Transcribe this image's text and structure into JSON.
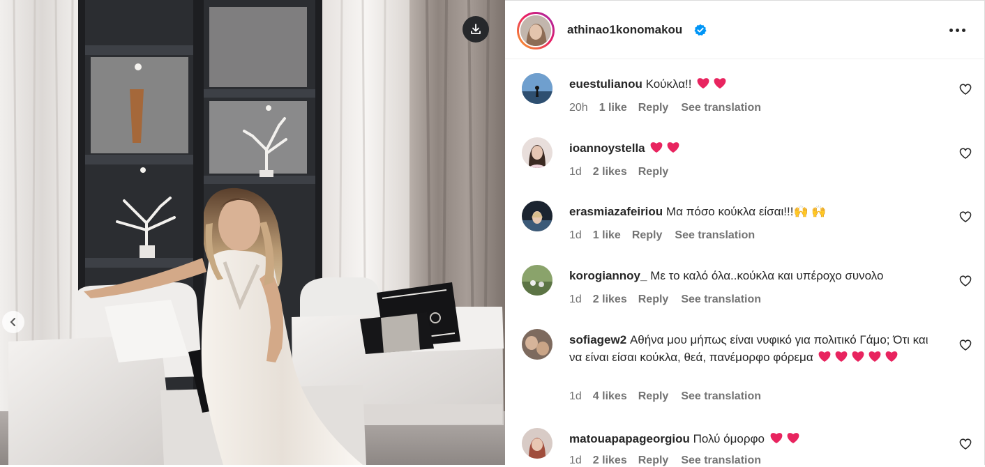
{
  "post": {
    "username": "athinao1konomakou",
    "verified": true,
    "download_icon": "download-icon",
    "prev_icon": "chevron-left-icon",
    "more_icon": "more-options-icon"
  },
  "colors": {
    "verified_blue": "#0095f6",
    "heart_emoji": "#e8245f",
    "meta_grey": "#737373"
  },
  "comments": [
    {
      "user": "euestulianou",
      "text": "Κούκλα!!",
      "emoji_hearts": 2,
      "time": "20h",
      "likes": "1 like",
      "reply": "Reply",
      "translate": "See translation"
    },
    {
      "user": "ioannoystella",
      "text": "",
      "emoji_hearts": 2,
      "time": "1d",
      "likes": "2 likes",
      "reply": "Reply",
      "translate": ""
    },
    {
      "user": "erasmiazafeiriou",
      "text": "Μα πόσο κούκλα είσαι!!!🙌 🙌",
      "emoji_hearts": 0,
      "time": "1d",
      "likes": "1 like",
      "reply": "Reply",
      "translate": "See translation"
    },
    {
      "user": "korogiannoy_",
      "text": "Με το καλό όλα..κούκλα και υπέροχο συνολο",
      "emoji_hearts": 0,
      "time": "1d",
      "likes": "2 likes",
      "reply": "Reply",
      "translate": "See translation"
    },
    {
      "user": "sofiagew2",
      "text": "Αθήνα μου μήπως είναι νυφικό για πολιτικό Γάμο; Ότι και να είναι είσαι κούκλα, θεά, πανέμορφο φόρεμα",
      "emoji_hearts": 5,
      "time": "1d",
      "likes": "4 likes",
      "reply": "Reply",
      "translate": "See translation"
    },
    {
      "user": "matouapapageorgiou",
      "text": "Πολύ όμορφο",
      "emoji_hearts": 2,
      "time": "1d",
      "likes": "2 likes",
      "reply": "Reply",
      "translate": "See translation"
    }
  ]
}
